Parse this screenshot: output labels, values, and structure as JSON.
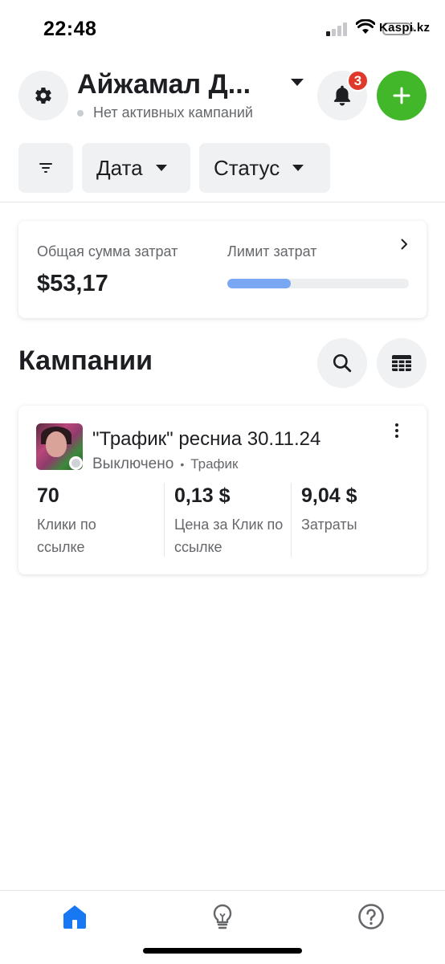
{
  "status_bar": {
    "time": "22:48",
    "carrier": "Kaspi.kz"
  },
  "header": {
    "account_name": "Айжамал Д...",
    "account_status": "Нет активных кампаний",
    "notifications_count": "3",
    "icons": {
      "settings": "gear-icon",
      "notifications": "bell-icon",
      "add": "plus-icon"
    }
  },
  "filters": {
    "filter_icon": "filter-icon",
    "date_label": "Дата",
    "status_label": "Статус"
  },
  "spend_summary": {
    "total_label": "Общая сумма затрат",
    "total_value": "$53,17",
    "limit_label": "Лимит затрат",
    "limit_progress_fraction": 0.35
  },
  "campaigns": {
    "title": "Кампании",
    "items": [
      {
        "name": "\"Трафик\" ресниа 30.11.24",
        "state": "Выключено",
        "separator": "•",
        "objective": "Трафик",
        "metrics": [
          {
            "value": "70",
            "label": "Клики по ссылке"
          },
          {
            "value": "0,13 $",
            "label": "Цена за Клик по ссылке"
          },
          {
            "value": "9,04 $",
            "label": "Затраты"
          }
        ]
      }
    ]
  },
  "bottom_nav": {
    "items": [
      {
        "icon": "home-icon",
        "active": true
      },
      {
        "icon": "lightbulb-icon",
        "active": false
      },
      {
        "icon": "help-icon",
        "active": false
      }
    ]
  },
  "colors": {
    "accent_blue": "#1877f2",
    "add_green": "#42b72a",
    "badge_red": "#e0392b",
    "progress_blue": "#7aa7f4",
    "text_primary": "#1c1e21",
    "text_secondary": "#65676b",
    "chip_bg": "#eff1f3"
  }
}
